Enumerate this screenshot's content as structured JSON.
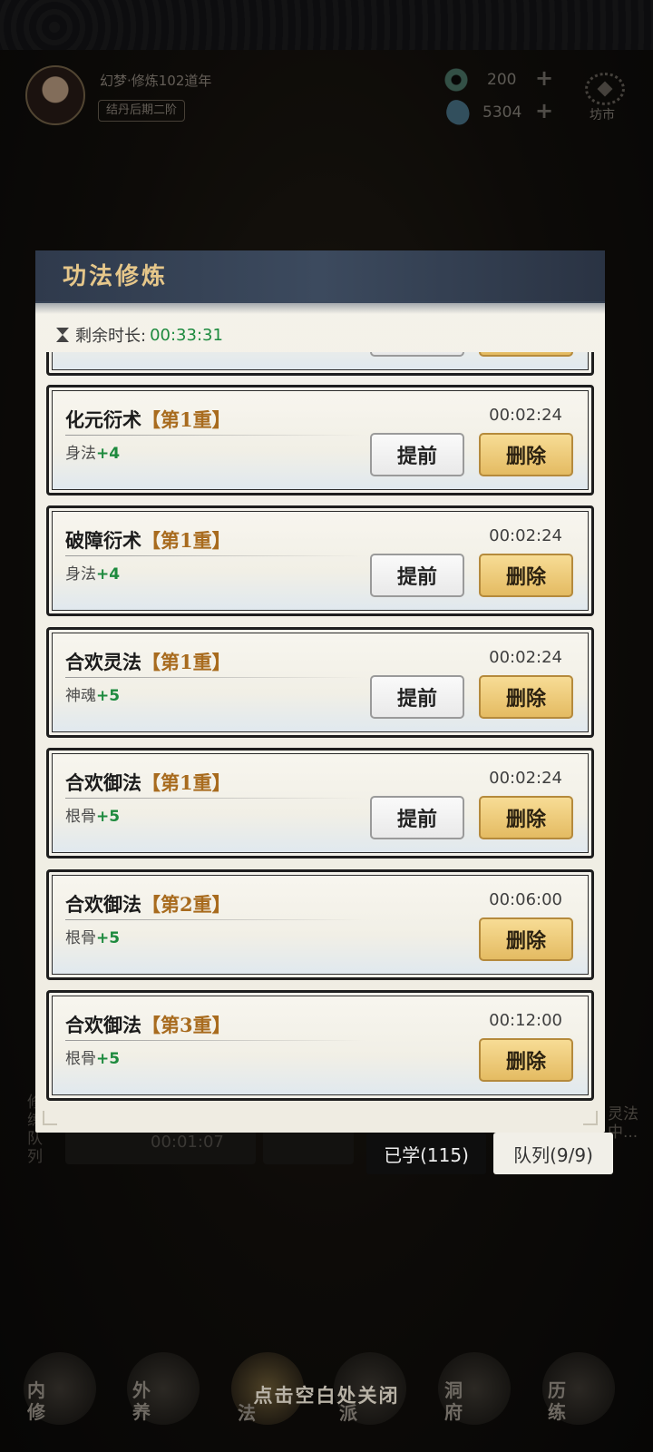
{
  "player": {
    "name": "幻梦·修炼102道年",
    "rank": "结丹后期二阶"
  },
  "resources": {
    "jade": "200",
    "stone": "5304",
    "market_label": "坊市"
  },
  "background": {
    "side_left": "修\n练\n队\n列",
    "side_right": "灵法\n中...",
    "queue_time": "00:01:07"
  },
  "modal": {
    "title": "功法修炼",
    "remaining_label": "剩余时长:",
    "remaining_value": "00:33:31",
    "advance_label": "提前",
    "delete_label": "删除",
    "entries": [
      {
        "name": "化元衍术",
        "level": "【第1重】",
        "stat": "身法",
        "bonus": "+4",
        "time": "00:02:24"
      },
      {
        "name": "破障衍术",
        "level": "【第1重】",
        "stat": "身法",
        "bonus": "+4",
        "time": "00:02:24"
      },
      {
        "name": "合欢灵法",
        "level": "【第1重】",
        "stat": "神魂",
        "bonus": "+5",
        "time": "00:02:24"
      },
      {
        "name": "合欢御法",
        "level": "【第1重】",
        "stat": "根骨",
        "bonus": "+5",
        "time": "00:02:24"
      },
      {
        "name": "合欢御法",
        "level": "【第2重】",
        "stat": "根骨",
        "bonus": "+5",
        "time": "00:06:00"
      },
      {
        "name": "合欢御法",
        "level": "【第3重】",
        "stat": "根骨",
        "bonus": "+5",
        "time": "00:12:00"
      }
    ]
  },
  "tabs": {
    "learned": "已学(115)",
    "queue": "队列(9/9)"
  },
  "nav": {
    "items": [
      "内\n修",
      "外\n养",
      "法",
      "派",
      "洞\n府",
      "历\n练"
    ]
  },
  "close_hint": "点击空白处关闭"
}
